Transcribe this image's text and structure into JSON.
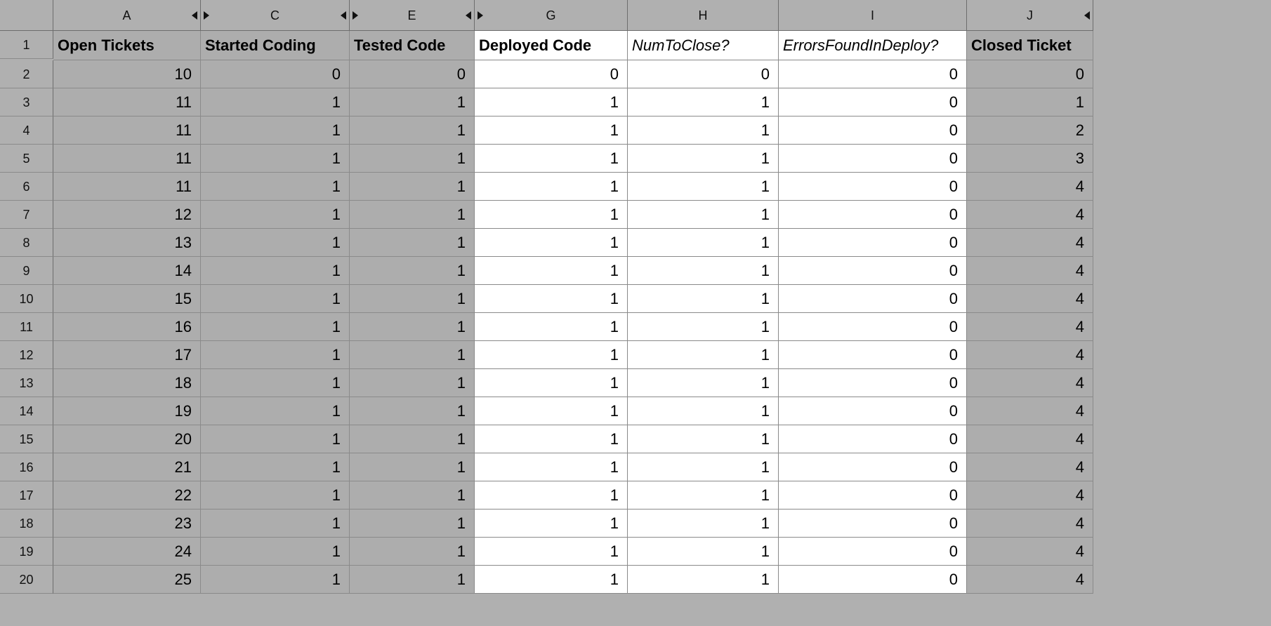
{
  "columns": [
    {
      "letter": "A",
      "label": "Open Tickets",
      "bold": true,
      "italic": false,
      "selected": true,
      "showLeft": false,
      "showRight": true
    },
    {
      "letter": "C",
      "label": "Started Coding",
      "bold": true,
      "italic": false,
      "selected": true,
      "showLeft": true,
      "showRight": true
    },
    {
      "letter": "E",
      "label": "Tested Code",
      "bold": true,
      "italic": false,
      "selected": true,
      "showLeft": true,
      "showRight": true
    },
    {
      "letter": "G",
      "label": "Deployed Code",
      "bold": true,
      "italic": false,
      "selected": false,
      "showLeft": true,
      "showRight": false
    },
    {
      "letter": "H",
      "label": "NumToClose?",
      "bold": false,
      "italic": true,
      "selected": false,
      "showLeft": false,
      "showRight": false
    },
    {
      "letter": "I",
      "label": "ErrorsFoundInDeploy?",
      "bold": false,
      "italic": true,
      "selected": false,
      "showLeft": false,
      "showRight": false
    },
    {
      "letter": "J",
      "label": "Closed Ticket",
      "bold": true,
      "italic": false,
      "selected": true,
      "showLeft": false,
      "showRight": true
    }
  ],
  "rows": [
    {
      "n": 1
    },
    {
      "n": 2,
      "v": [
        10,
        0,
        0,
        0,
        0,
        0,
        0
      ]
    },
    {
      "n": 3,
      "v": [
        11,
        1,
        1,
        1,
        1,
        0,
        1
      ]
    },
    {
      "n": 4,
      "v": [
        11,
        1,
        1,
        1,
        1,
        0,
        2
      ]
    },
    {
      "n": 5,
      "v": [
        11,
        1,
        1,
        1,
        1,
        0,
        3
      ]
    },
    {
      "n": 6,
      "v": [
        11,
        1,
        1,
        1,
        1,
        0,
        4
      ]
    },
    {
      "n": 7,
      "v": [
        12,
        1,
        1,
        1,
        1,
        0,
        4
      ]
    },
    {
      "n": 8,
      "v": [
        13,
        1,
        1,
        1,
        1,
        0,
        4
      ]
    },
    {
      "n": 9,
      "v": [
        14,
        1,
        1,
        1,
        1,
        0,
        4
      ]
    },
    {
      "n": 10,
      "v": [
        15,
        1,
        1,
        1,
        1,
        0,
        4
      ]
    },
    {
      "n": 11,
      "v": [
        16,
        1,
        1,
        1,
        1,
        0,
        4
      ]
    },
    {
      "n": 12,
      "v": [
        17,
        1,
        1,
        1,
        1,
        0,
        4
      ]
    },
    {
      "n": 13,
      "v": [
        18,
        1,
        1,
        1,
        1,
        0,
        4
      ]
    },
    {
      "n": 14,
      "v": [
        19,
        1,
        1,
        1,
        1,
        0,
        4
      ]
    },
    {
      "n": 15,
      "v": [
        20,
        1,
        1,
        1,
        1,
        0,
        4
      ]
    },
    {
      "n": 16,
      "v": [
        21,
        1,
        1,
        1,
        1,
        0,
        4
      ]
    },
    {
      "n": 17,
      "v": [
        22,
        1,
        1,
        1,
        1,
        0,
        4
      ]
    },
    {
      "n": 18,
      "v": [
        23,
        1,
        1,
        1,
        1,
        0,
        4
      ]
    },
    {
      "n": 19,
      "v": [
        24,
        1,
        1,
        1,
        1,
        0,
        4
      ]
    },
    {
      "n": 20,
      "v": [
        25,
        1,
        1,
        1,
        1,
        0,
        4
      ]
    }
  ]
}
